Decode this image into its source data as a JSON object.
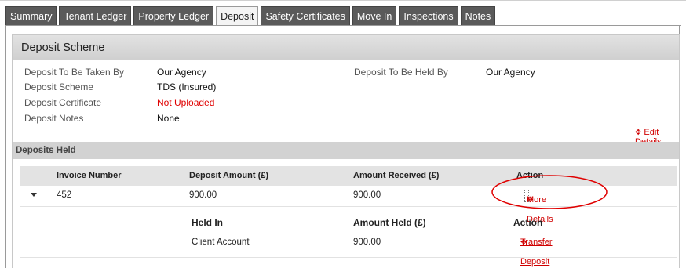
{
  "tabs": [
    {
      "label": "Summary",
      "active": false
    },
    {
      "label": "Tenant Ledger",
      "active": false
    },
    {
      "label": "Property Ledger",
      "active": false
    },
    {
      "label": "Deposit",
      "active": true
    },
    {
      "label": "Safety Certificates",
      "active": false
    },
    {
      "label": "Move In",
      "active": false
    },
    {
      "label": "Inspections",
      "active": false
    },
    {
      "label": "Notes",
      "active": false
    }
  ],
  "panel": {
    "title": "Deposit Scheme"
  },
  "scheme": {
    "taken_by_label": "Deposit To Be Taken By",
    "taken_by_value": "Our Agency",
    "held_by_label": "Deposit To Be Held By",
    "held_by_value": "Our Agency",
    "scheme_label": "Deposit Scheme",
    "scheme_value": "TDS (Insured)",
    "certificate_label": "Deposit Certificate",
    "certificate_value": "Not Uploaded",
    "notes_label": "Deposit Notes",
    "notes_value": "None",
    "edit_link": "Edit Details"
  },
  "deposits_held": {
    "title": "Deposits Held",
    "columns": [
      "Invoice Number",
      "Deposit Amount (£)",
      "Amount Received (£)",
      "Action"
    ],
    "rows": [
      {
        "invoice": "452",
        "deposit_amount": "900.00",
        "amount_received": "900.00",
        "action": "More Details"
      }
    ],
    "detail": {
      "columns": [
        "Held In",
        "Amount Held (£)",
        "Action"
      ],
      "rows": [
        {
          "held_in": "Client Account",
          "amount_held": "900.00",
          "action": "Transfer Deposit"
        }
      ]
    }
  },
  "colors": {
    "link_red": "#d00000",
    "annotation_red": "#e00000",
    "tab_dark": "#5a5a5a"
  },
  "icons": {
    "link_icon": "move-arrows-icon",
    "expand_icon": "caret-down-icon"
  }
}
